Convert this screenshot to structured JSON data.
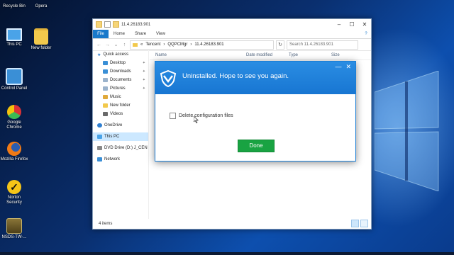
{
  "desktop": {
    "icons": [
      {
        "label": "Recycle Bin",
        "icon": "recycle-bin-icon",
        "color": "#9fb7d6"
      },
      {
        "label": "Opera",
        "icon": "opera-icon",
        "color": "#e0232d"
      },
      {
        "label": "This PC",
        "icon": "computer-icon",
        "color": "#4aa3e8"
      },
      {
        "label": "New folder",
        "icon": "folder-icon",
        "color": "#f2c94c"
      },
      {
        "label": "Control Panel",
        "icon": "control-panel-icon",
        "color": "#3a8fd6"
      },
      {
        "label": "Google Chrome",
        "icon": "chrome-icon",
        "color": "#e9b31c"
      },
      {
        "label": "Mozilla Firefox",
        "icon": "firefox-icon",
        "color": "#f07a16"
      },
      {
        "label": "Norton Security",
        "icon": "norton-icon",
        "color": "#f5c518"
      },
      {
        "label": "NSDS-TW-...",
        "icon": "nsds-icon",
        "color": "#6b5a2a"
      }
    ]
  },
  "explorer": {
    "title": "11.4.26183.901",
    "ribbon": {
      "file": "File",
      "tabs": [
        "Home",
        "Share",
        "View"
      ]
    },
    "breadcrumb": [
      "Tencent",
      "QQPCMgr",
      "11.4.26183.901"
    ],
    "search_placeholder": "Search 11.4.26183.901",
    "columns": [
      "Name",
      "Date modified",
      "Type",
      "Size"
    ],
    "nav": {
      "quick_access": "Quick access",
      "quick_items": [
        {
          "label": "Desktop",
          "pinned": true,
          "color": "#3a8fd6"
        },
        {
          "label": "Downloads",
          "pinned": true,
          "color": "#3a8fd6"
        },
        {
          "label": "Documents",
          "pinned": true,
          "color": "#9bb3cc"
        },
        {
          "label": "Pictures",
          "pinned": true,
          "color": "#9bb3cc"
        },
        {
          "label": "Music",
          "pinned": false,
          "color": "#e0a93a"
        },
        {
          "label": "New folder",
          "pinned": false,
          "color": "#f2c94c"
        },
        {
          "label": "Videos",
          "pinned": false,
          "color": "#6a6a6a"
        }
      ],
      "onedrive": "OneDrive",
      "this_pc": "This PC",
      "dvd": "DVD Drive (D:) J_CEN",
      "network": "Network"
    },
    "status": "4 items"
  },
  "dialog": {
    "message": "Uninstalled. Hope to see you again.",
    "checkbox_label": "Delete configuration files",
    "checkbox_checked": false,
    "done": "Done",
    "brand_color": "#1a7ed6",
    "done_color": "#19a342"
  }
}
